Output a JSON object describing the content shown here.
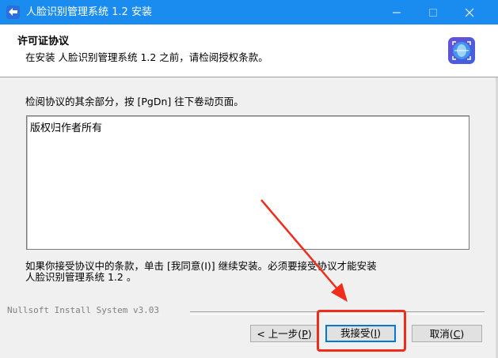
{
  "window": {
    "title": "人脸识别管理系统 1.2 安装"
  },
  "header": {
    "title": "许可证协议",
    "subtitle": "在安装 人脸识别管理系统 1.2 之前，请检阅授权条款。"
  },
  "main": {
    "instruction": "检阅协议的其余部分，按 [PgDn] 往下卷动页面。",
    "license_text": "版权归作者所有",
    "accept_line1": "如果你接受协议中的条款，单击 [我同意(I)] 继续安装。必须要接受协议才能安装",
    "accept_line2": "人脸识别管理系统 1.2 。"
  },
  "footer": {
    "branding": "Nullsoft Install System v3.03",
    "back_button": {
      "text": "< 上一步(",
      "key": "P",
      "end": ")"
    },
    "agree_button": {
      "text": "我接受(",
      "key": "I",
      "end": ")"
    },
    "cancel_button": {
      "text": "取消(",
      "key": "C",
      "end": ")"
    }
  },
  "colors": {
    "titlebar": "#1a8cf0",
    "annotation": "#f02c1a"
  }
}
